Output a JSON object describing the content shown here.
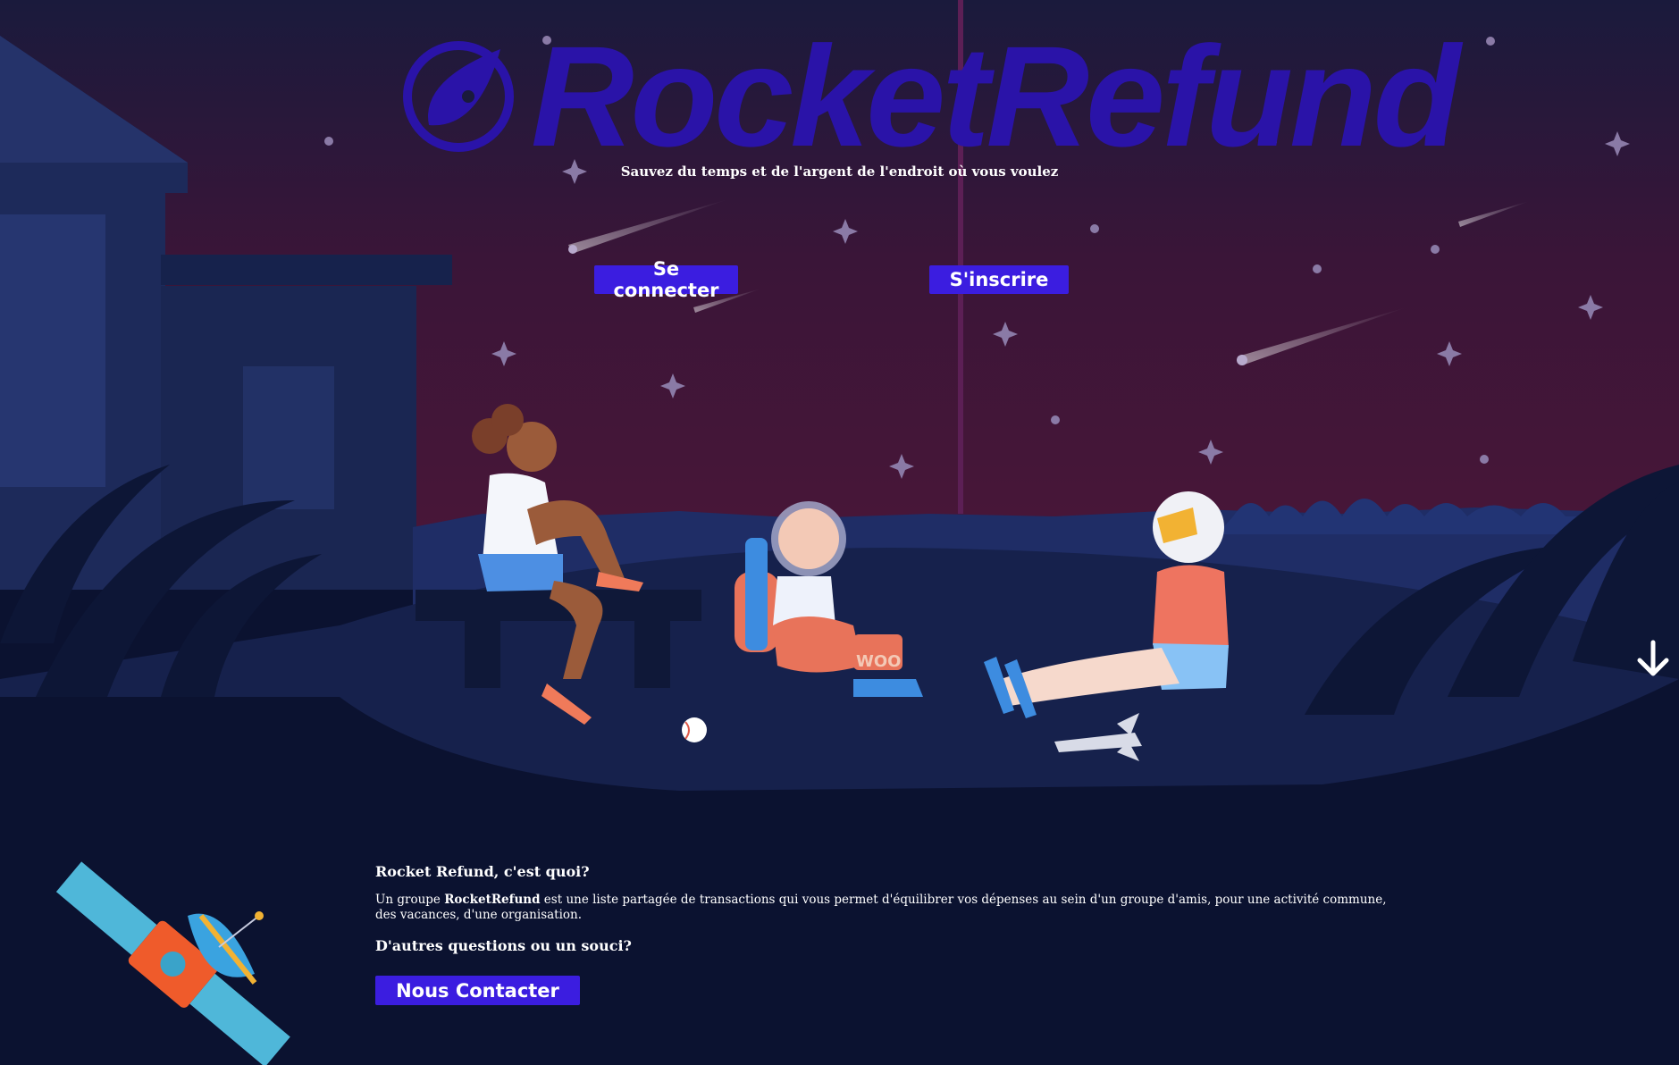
{
  "brand": {
    "name": "RocketRefund"
  },
  "hero": {
    "tagline": "Sauvez du temps et de l'argent de l'endroit où vous voulez",
    "login_label": "Se connecter",
    "signup_label": "S'inscrire",
    "scroll_icon": "arrow-down-icon"
  },
  "about": {
    "title": "Rocket Refund, c'est quoi?",
    "desc_prefix": "Un groupe ",
    "desc_brand": "RocketRefund",
    "desc_suffix": " est une liste partagée de transactions qui vous permet d'équilibrer vos dépenses au sein d'un groupe d'amis, pour une activité commune, des vacances, d'une organisation.",
    "questions": "D'autres questions ou un souci?",
    "contact_label": "Nous Contacter"
  },
  "illustration": {
    "ball_text": "",
    "seat_text": "WOO"
  },
  "colors": {
    "accent": "#3b1de0",
    "logo": "#2a13a8",
    "sky_top": "#1a1a3c",
    "sky_bottom": "#4a1638",
    "ground": "#0b1230"
  }
}
